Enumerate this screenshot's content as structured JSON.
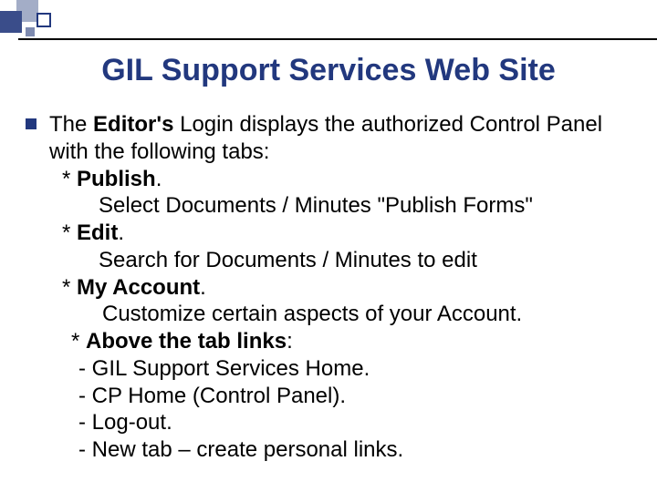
{
  "title": "GIL Support Services Web Site",
  "intro_before": "The ",
  "intro_bold": "Editor's",
  "intro_after": " Login displays the authorized Control Panel with the following tabs:",
  "tabs": [
    {
      "heading": "Publish",
      "desc": "Select Documents / Minutes \"Publish Forms\""
    },
    {
      "heading": "Edit",
      "desc": "Search for Documents / Minutes to edit"
    },
    {
      "heading": "My Account",
      "desc": "Customize certain aspects of your Account."
    }
  ],
  "above_label": "Above the tab links",
  "links": [
    "GIL Support Services Home.",
    "CP Home (Control Panel).",
    "Log-out.",
    "New tab – create personal links."
  ],
  "colors": {
    "accent": "#22387e"
  }
}
